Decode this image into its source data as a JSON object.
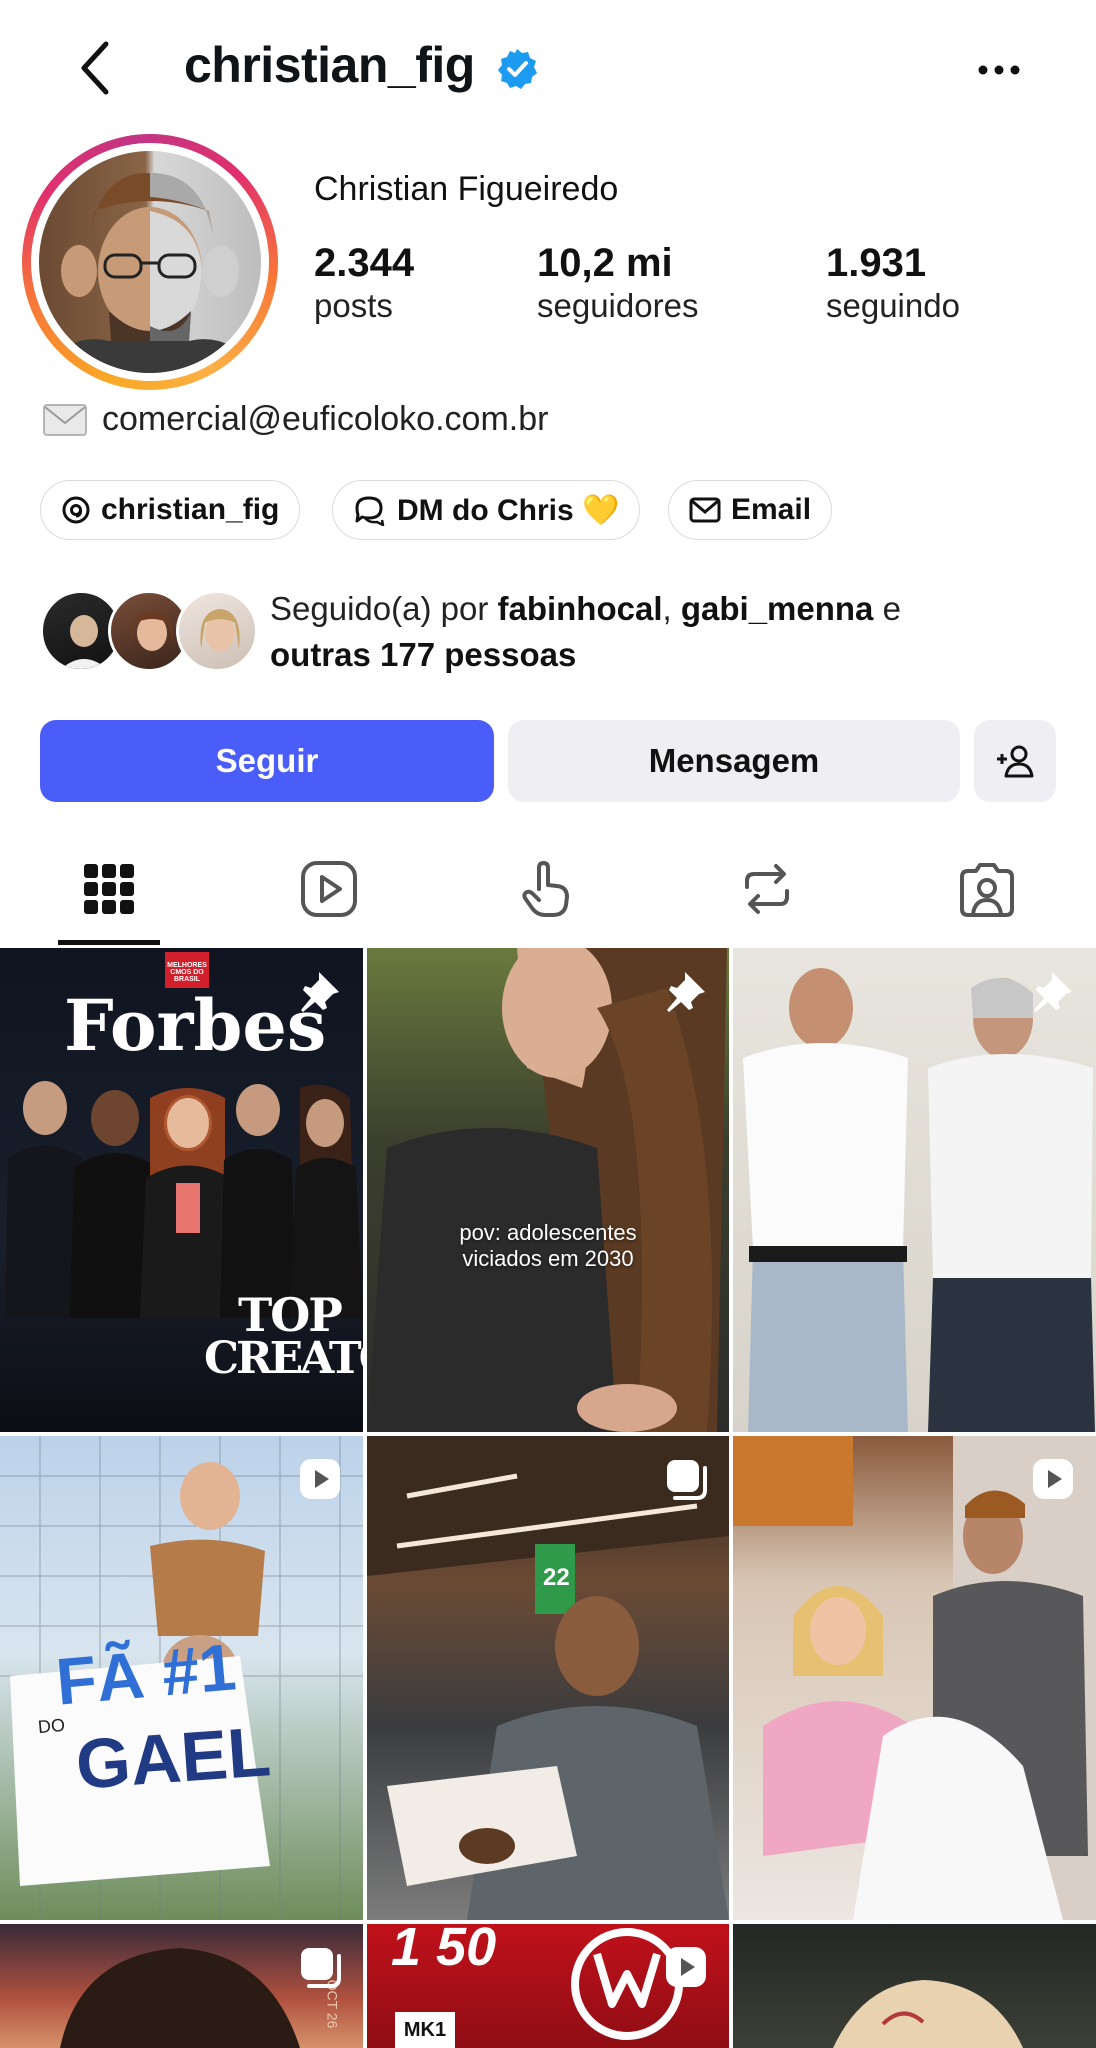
{
  "header": {
    "handle": "christian_fig"
  },
  "profile": {
    "full_name": "Christian Figueiredo",
    "stats": [
      {
        "num": "2.344",
        "label": "posts"
      },
      {
        "num": "10,2 mi",
        "label": "seguidores"
      },
      {
        "num": "1.931",
        "label": "seguindo"
      }
    ],
    "email": "comercial@euficoloko.com.br"
  },
  "chips": [
    {
      "label": "christian_fig",
      "icon": "threads-icon"
    },
    {
      "label": "DM do Chris 💛",
      "icon": "chat-icon"
    },
    {
      "label": "Email",
      "icon": "mail-icon"
    }
  ],
  "followed_by": {
    "prefix": "Seguido(a) por ",
    "user1": "fabinhocal",
    "sep": ", ",
    "user2": "gabi_menna",
    "and": " e",
    "others": "outras 177 pessoas"
  },
  "actions": {
    "follow": "Seguir",
    "message": "Mensagem"
  },
  "tabs": [
    "grid-icon",
    "reels-icon",
    "tagged-hand-icon",
    "reposts-icon",
    "tagged-user-icon"
  ],
  "posts": [
    {
      "type": "pinned",
      "logo": "Forbes",
      "top": "TOP",
      "creators": "CREATORS",
      "tag": "MELHORES CMOS DO BRASIL"
    },
    {
      "type": "pinned",
      "caption1": "pov: adolescentes",
      "caption2": "viciados em 2030"
    },
    {
      "type": "pinned"
    },
    {
      "type": "reel",
      "sign1": "FÃ #1",
      "sign2": "DO",
      "sign3": "GAEL"
    },
    {
      "type": "carousel",
      "gate": "22"
    },
    {
      "type": "reel"
    },
    {
      "type": "carousel",
      "side": "OCT 26"
    },
    {
      "type": "reel",
      "number": "1 50",
      "plate": "MK1"
    },
    {
      "type": "post"
    }
  ],
  "colors": {
    "follow_button": "#4a5df9",
    "secondary_button": "#efeff3",
    "verified": "#1d9bf0"
  }
}
